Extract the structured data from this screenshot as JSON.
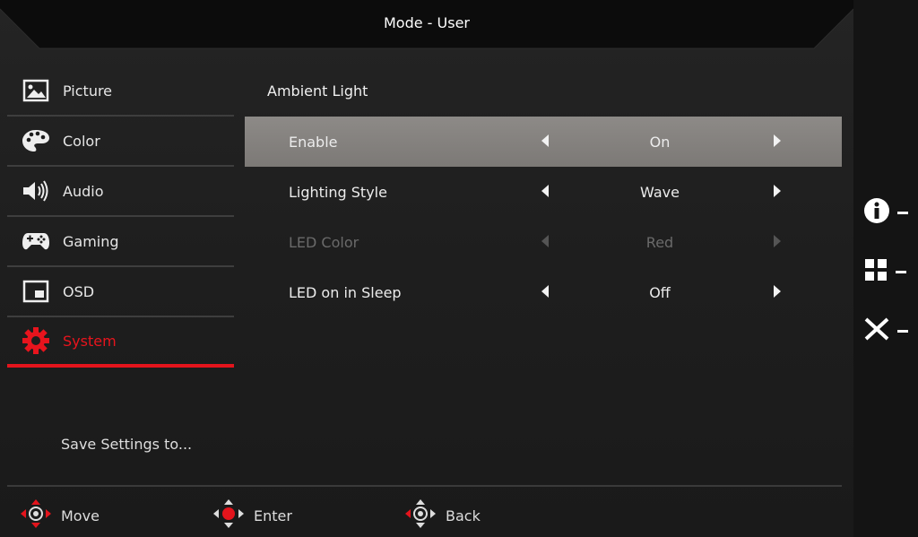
{
  "header": {
    "title": "Mode - User"
  },
  "sidebar": {
    "items": [
      {
        "label": "Picture",
        "icon": "picture-icon"
      },
      {
        "label": "Color",
        "icon": "palette-icon"
      },
      {
        "label": "Audio",
        "icon": "speaker-icon"
      },
      {
        "label": "Gaming",
        "icon": "gamepad-icon"
      },
      {
        "label": "OSD",
        "icon": "osd-icon"
      },
      {
        "label": "System",
        "icon": "gear-icon",
        "active": true
      }
    ],
    "save_settings": "Save Settings to..."
  },
  "main": {
    "section_title": "Ambient Light",
    "rows": [
      {
        "label": "Enable",
        "value": "On",
        "selected": true
      },
      {
        "label": "Lighting Style",
        "value": "Wave"
      },
      {
        "label": "LED Color",
        "value": "Red",
        "disabled": true
      },
      {
        "label": "LED on in Sleep",
        "value": "Off"
      }
    ]
  },
  "footer": {
    "move": "Move",
    "enter": "Enter",
    "back": "Back"
  },
  "side_keys": [
    "info-icon",
    "grid-icon",
    "close-icon"
  ],
  "colors": {
    "accent": "#e3141c",
    "highlight": "#858280",
    "background": "#1e1e1e"
  }
}
